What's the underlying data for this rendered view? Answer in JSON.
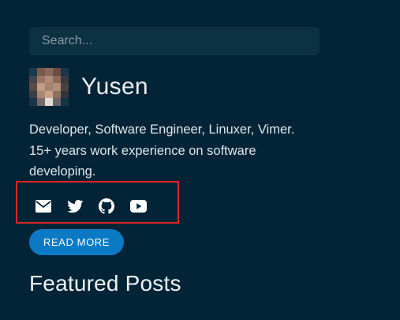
{
  "search": {
    "placeholder": "Search..."
  },
  "profile": {
    "name": "Yusen",
    "avatar_icon": "pixelated-avatar-photo",
    "bio_line1": "Developer, Software Engineer, Linuxer, Vimer.",
    "bio_line2": "15+ years work experience on software",
    "bio_line3": "developing."
  },
  "social": {
    "icons": [
      "envelope-icon",
      "twitter-icon",
      "github-icon",
      "youtube-icon"
    ]
  },
  "buttons": {
    "read_more": "READ MORE"
  },
  "sections": {
    "featured_title": "Featured Posts"
  },
  "colors": {
    "background": "#022436",
    "search_background": "#0b3142",
    "accent_button": "#0a7ac5",
    "highlight_border": "#e02424"
  }
}
